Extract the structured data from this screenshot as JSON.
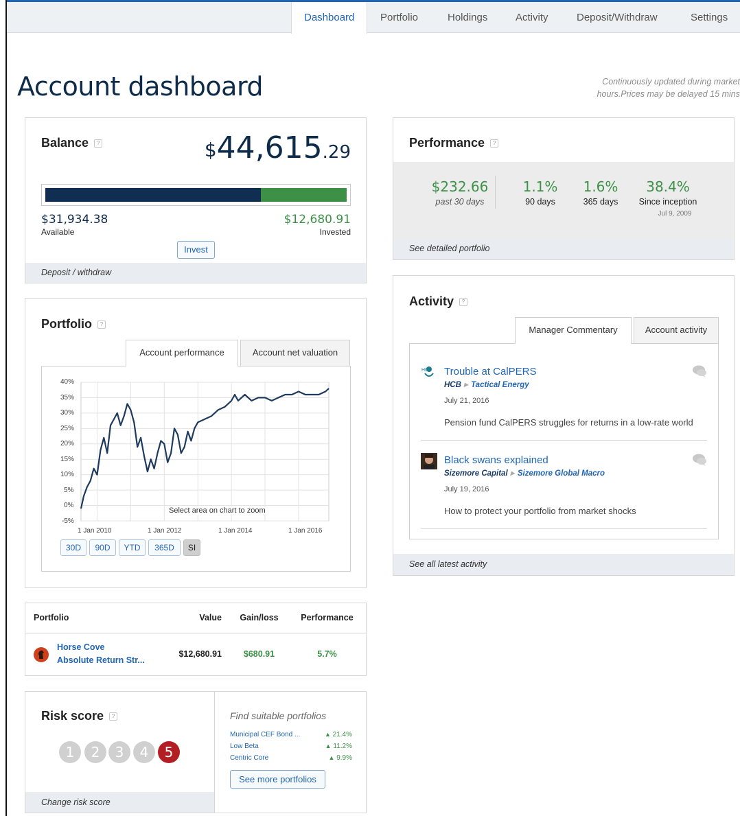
{
  "nav": {
    "tabs": [
      "Dashboard",
      "Portfolio",
      "Holdings",
      "Activity",
      "Deposit/Withdraw",
      "Settings"
    ],
    "active": "Dashboard"
  },
  "page": {
    "title": "Account dashboard",
    "update_note": "Continuously updated during market hours.Prices may be delayed 15 mins"
  },
  "balance": {
    "title": "Balance",
    "help": "?",
    "currency": "$",
    "amount_main": "44,615",
    "amount_cents": ".29",
    "available_amount": "$31,934.38",
    "available_label": "Available",
    "invested_amount": "$12,680.91",
    "invested_label": "Invested",
    "available_fraction": 0.716,
    "colors": {
      "available": "#0f2e52",
      "invested": "#3d9147"
    },
    "invest_button": "Invest",
    "footer_link": "Deposit / withdraw"
  },
  "performance": {
    "title": "Performance",
    "help": "?",
    "metrics": [
      {
        "value": "$232.66",
        "label": "past 30 days"
      },
      {
        "value": "1.1%",
        "label": "90 days"
      },
      {
        "value": "1.6%",
        "label": "365 days"
      },
      {
        "value": "38.4%",
        "label": "Since inception",
        "sub": "Jul 9, 2009"
      }
    ],
    "footer_link": "See detailed portfolio"
  },
  "portfolio_chart": {
    "title": "Portfolio",
    "help": "?",
    "tabs": [
      "Account performance",
      "Account net valuation"
    ],
    "zoom_hint": "Select area on chart to zoom",
    "range_buttons": [
      "30D",
      "90D",
      "YTD",
      "365D",
      "SI"
    ],
    "selected_range": "SI"
  },
  "chart_data": {
    "type": "line",
    "title": "",
    "xlabel": "",
    "ylabel": "",
    "y_ticks": [
      "40%",
      "35%",
      "30%",
      "25%",
      "20%",
      "15%",
      "10%",
      "5%",
      "0%",
      "-5%"
    ],
    "x_ticks": [
      "1 Jan 2010",
      "1 Jan 2012",
      "1 Jan 2014",
      "1 Jan 2016"
    ],
    "ylim": [
      -5,
      40
    ],
    "xlim": [
      2009.52,
      2016.9
    ],
    "grid": true,
    "series": [
      {
        "x": [
          2009.52,
          2009.6,
          2009.7,
          2009.8,
          2009.9,
          2010.0,
          2010.1,
          2010.2,
          2010.3,
          2010.4,
          2010.5,
          2010.6,
          2010.7,
          2010.8,
          2010.9,
          2011.0,
          2011.1,
          2011.2,
          2011.3,
          2011.4,
          2011.5,
          2011.6,
          2011.7,
          2011.8,
          2011.9,
          2012.0,
          2012.1,
          2012.2,
          2012.3,
          2012.4,
          2012.5,
          2012.6,
          2012.7,
          2012.8,
          2012.9,
          2013.0,
          2013.2,
          2013.4,
          2013.6,
          2013.8,
          2014.0,
          2014.1,
          2014.2,
          2014.4,
          2014.6,
          2014.8,
          2015.0,
          2015.2,
          2015.4,
          2015.6,
          2015.8,
          2016.0,
          2016.2,
          2016.4,
          2016.6,
          2016.8,
          2016.9
        ],
        "y": [
          -1,
          3,
          6,
          8,
          12,
          10,
          18,
          22,
          17,
          26,
          28,
          30,
          26,
          29,
          33,
          31,
          27,
          19,
          22,
          16,
          11,
          15,
          12,
          17,
          21,
          20,
          14,
          17,
          25,
          23,
          17,
          19,
          24,
          21,
          25,
          27,
          28,
          29,
          31,
          32,
          34,
          36,
          34,
          36,
          34,
          35,
          35,
          34,
          35,
          36,
          36,
          37,
          36,
          36,
          36,
          37,
          38
        ]
      }
    ]
  },
  "portfolio_table": {
    "headers": [
      "Portfolio",
      "Value",
      "Gain/loss",
      "Performance"
    ],
    "rows": [
      {
        "name": "Horse Cove",
        "strategy": "Absolute Return Str...",
        "value": "$12,680.91",
        "gain": "$680.91",
        "performance": "5.7%"
      }
    ]
  },
  "risk": {
    "title": "Risk score",
    "help": "?",
    "scores": [
      "1",
      "2",
      "3",
      "4",
      "5"
    ],
    "selected": "5",
    "footer_link": "Change risk score",
    "find_title": "Find suitable portfolios",
    "suggestions": [
      {
        "name": "Municipal CEF Bond ...",
        "change": "21.4%"
      },
      {
        "name": "Low Beta",
        "change": "11.2%"
      },
      {
        "name": "Centric Core",
        "change": "9.9%"
      }
    ],
    "see_more": "See more portfolios"
  },
  "activity": {
    "title": "Activity",
    "help": "?",
    "tabs": [
      "Manager Commentary",
      "Account activity"
    ],
    "items": [
      {
        "logo": "HCB",
        "title": "Trouble at CalPERS",
        "manager": "HCB",
        "strategy": "Tactical Energy",
        "date": "July 21, 2016",
        "description": "Pension fund CalPERS struggles for returns in a low-rate world"
      },
      {
        "title": "Black swans explained",
        "manager": "Sizemore Capital",
        "strategy": "Sizemore Global Macro",
        "date": "July 19, 2016",
        "description": "How to protect your portfolio from market shocks"
      }
    ],
    "footer_link": "See all latest activity"
  }
}
